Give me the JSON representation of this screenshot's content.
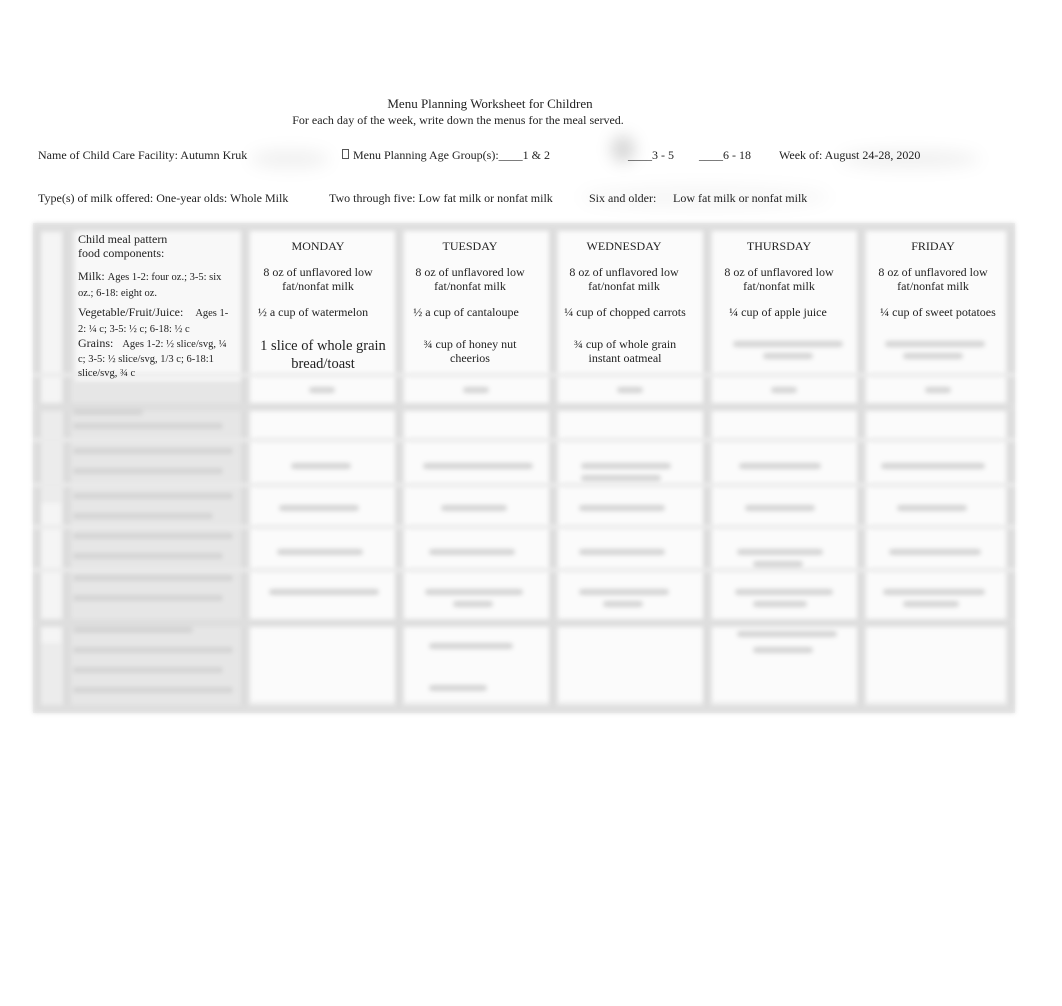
{
  "header": {
    "title": "Menu Planning Worksheet for Children",
    "subtitle": "For each day of the week, write down the menus for the meal served."
  },
  "info": {
    "facility_label": "Name of Child Care Facility: Autumn Kruk",
    "age_group_icon": "missing-glyph-box",
    "age_group_label": "Menu Planning Age Group(s):____1 & 2",
    "age_group_option_2": "____3 - 5",
    "age_group_option_3": "____6 - 18",
    "week_of": "Week of: August 24-28, 2020"
  },
  "milk_types": {
    "one_year": "Type(s) of milk offered: One-year olds: Whole Milk",
    "two_to_five": "Two through five: Low fat milk or nonfat milk",
    "six_older_label": "Six and older:",
    "six_older_value": "Low fat milk or nonfat milk"
  },
  "table": {
    "header_label_line1": "Child meal pattern",
    "header_label_line2": "food components:",
    "days": [
      "MONDAY",
      "TUESDAY",
      "WEDNESDAY",
      "THURSDAY",
      "FRIDAY"
    ],
    "components": [
      {
        "name": "Milk:",
        "detail": "Ages 1-2: four oz.; 3-5: six oz.; 6-18: eight oz.",
        "values": [
          "8 oz of unflavored low fat/nonfat milk",
          "8 oz of unflavored low fat/nonfat milk",
          "8 oz of unflavored low fat/nonfat milk",
          "8 oz of unflavored low fat/nonfat milk",
          "8 oz of unflavored low fat/nonfat milk"
        ]
      },
      {
        "name": "Vegetable/Fruit/Juice:",
        "detail": "Ages 1-2: ¼ c; 3-5: ½ c; 6-18: ½ c",
        "values": [
          "½ a cup of watermelon",
          "½ a cup of cantaloupe",
          "¼ cup of chopped carrots",
          "¼ cup of apple juice",
          "¼ cup of sweet potatoes"
        ]
      },
      {
        "name": "Grains:",
        "detail": "Ages 1-2: ½ slice/svg, ¼ c; 3-5: ½ slice/svg, 1/3 c; 6-18:1 slice/svg, ¾ c",
        "values": [
          "1 slice of whole grain bread/toast",
          "¾ cup of honey nut cheerios",
          "¾ cup of whole grain instant oatmeal",
          "",
          ""
        ]
      }
    ]
  }
}
